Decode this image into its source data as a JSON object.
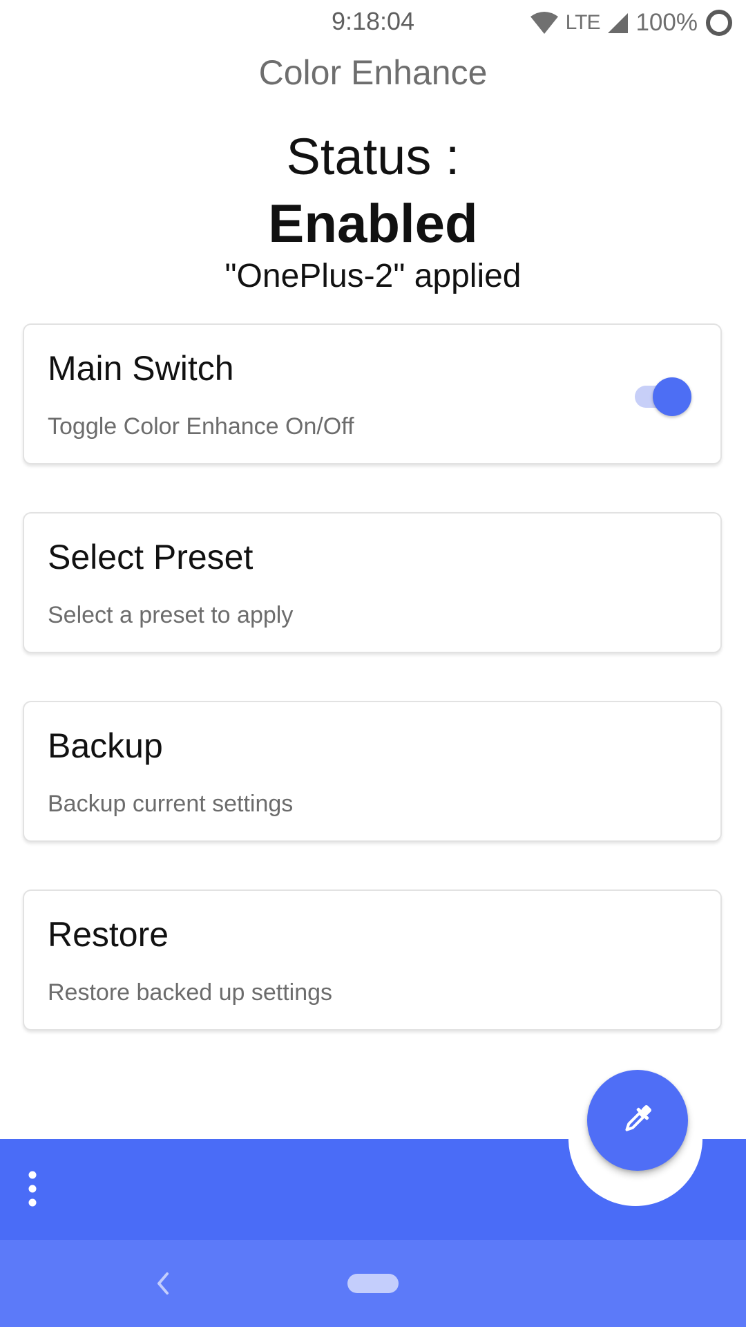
{
  "status_bar": {
    "time": "9:18:04",
    "network": "LTE",
    "battery": "100%",
    "icons": [
      "wifi-icon",
      "signal-icon",
      "battery-icon"
    ]
  },
  "app": {
    "title": "Color Enhance"
  },
  "status": {
    "label": "Status :",
    "value": "Enabled",
    "applied": "\"OnePlus-2\" applied"
  },
  "cards": [
    {
      "title": "Main Switch",
      "subtitle": "Toggle Color Enhance On/Off",
      "toggle_on": true
    },
    {
      "title": "Select Preset",
      "subtitle": "Select a preset to apply"
    },
    {
      "title": "Backup",
      "subtitle": "Backup current settings"
    },
    {
      "title": "Restore",
      "subtitle": "Restore backed up settings"
    }
  ],
  "bottom_bar": {
    "menu_icon": "more-vert-icon",
    "fab_icon": "eyedropper-icon"
  },
  "navigation": {
    "back_icon": "back-chevron-icon",
    "home_icon": "home-pill-icon"
  },
  "colors": {
    "accent": "#4a6cf7",
    "nav_bar": "#5c7af9",
    "toggle_track": "#c7cff8",
    "toggle_thumb": "#4d6ef4"
  }
}
